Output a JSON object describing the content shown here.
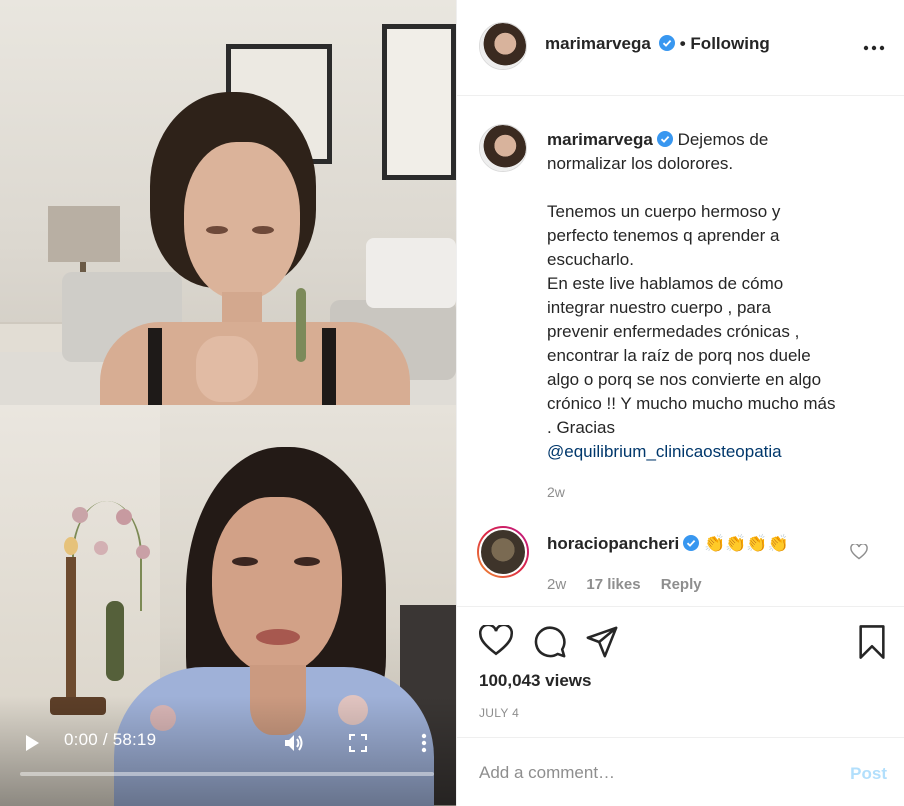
{
  "video": {
    "current_time": "0:00",
    "separator": "/",
    "duration": "58:19",
    "progress": 0.0
  },
  "post": {
    "author": "marimarvega",
    "follow_status": "• Following",
    "more_icon": "more-horizontal-icon"
  },
  "caption": {
    "author": "marimarvega",
    "lines": [
      "Dejemos de",
      "normalizar los dolorores.",
      "",
      "Tenemos un cuerpo hermoso y",
      "perfecto tenemos q aprender a",
      "escucharlo.",
      "En este live hablamos de cómo",
      "integrar nuestro cuerpo , para",
      "prevenir enfermedades crónicas ,",
      "encontrar la raíz de porq nos duele",
      "algo o porq se nos convierte en algo",
      "crónico !! Y mucho mucho mucho más",
      ". Gracias"
    ],
    "mention": "@equilibrium_clinicaosteopatia",
    "age": "2w"
  },
  "comment": {
    "author": "horaciopancheri",
    "text": "👏👏👏👏",
    "age": "2w",
    "likes": "17 likes",
    "reply": "Reply"
  },
  "stats": {
    "views": "100,043 views",
    "date": "JULY 4"
  },
  "add_comment": {
    "placeholder": "Add a comment…",
    "post_label": "Post"
  },
  "colors": {
    "verified": "#3897f0",
    "link": "#00376b",
    "muted": "#8e8e8e",
    "post_disabled": "#b2dffc"
  }
}
